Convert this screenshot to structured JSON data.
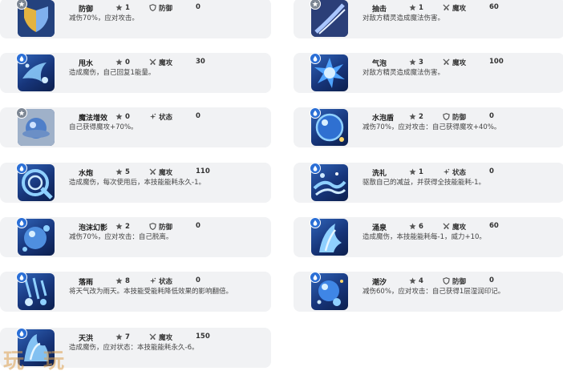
{
  "skills_left": [
    {
      "name": "防御",
      "cost": "1",
      "category": "防御",
      "power": "0",
      "desc": "减伤70%，应对攻击。",
      "badge": "normal",
      "art": "shield-art"
    },
    {
      "name": "甩水",
      "cost": "0",
      "category": "魔攻",
      "power": "30",
      "desc": "造成魔伤，自己回复1能量。",
      "badge": "water",
      "art": "water-splash-art"
    },
    {
      "name": "魔法增效",
      "cost": "0",
      "category": "状态",
      "power": "0",
      "desc": "自己获得魔攻+70%。",
      "badge": "normal",
      "art": "magic-orb-art"
    },
    {
      "name": "水炮",
      "cost": "5",
      "category": "魔攻",
      "power": "110",
      "desc": "造成魔伤，每次使用后，本技能能耗永久-1。",
      "badge": "water",
      "art": "water-cannon-art"
    },
    {
      "name": "泡沫幻影",
      "cost": "2",
      "category": "防御",
      "power": "0",
      "desc": "减伤70%，应对攻击：自己脱离。",
      "badge": "water",
      "art": "bubble-art"
    },
    {
      "name": "落雨",
      "cost": "8",
      "category": "状态",
      "power": "0",
      "desc": "将天气改为雨天。本技能受能耗降低效果的影响翻倍。",
      "badge": "water",
      "art": "rain-art"
    },
    {
      "name": "天洪",
      "cost": "7",
      "category": "魔攻",
      "power": "150",
      "desc": "造成魔伤，应对状态：本技能能耗永久-6。",
      "badge": "water",
      "art": "flood-art"
    }
  ],
  "skills_right": [
    {
      "name": "抽击",
      "cost": "1",
      "category": "魔攻",
      "power": "60",
      "desc": "对敌方精灵造成魔法伤害。",
      "badge": "normal",
      "art": "lash-art"
    },
    {
      "name": "气泡",
      "cost": "3",
      "category": "魔攻",
      "power": "100",
      "desc": "对敌方精灵造成魔法伤害。",
      "badge": "water",
      "art": "bubble-burst-art"
    },
    {
      "name": "水泡盾",
      "cost": "2",
      "category": "防御",
      "power": "0",
      "desc": "减伤70%，应对攻击：自己获得魔攻+40%。",
      "badge": "water",
      "art": "bubble-shield-art"
    },
    {
      "name": "洗礼",
      "cost": "1",
      "category": "状态",
      "power": "0",
      "desc": "驱散自己的减益，并获得全技能能耗-1。",
      "badge": "water",
      "art": "baptism-art"
    },
    {
      "name": "涌泉",
      "cost": "6",
      "category": "魔攻",
      "power": "60",
      "desc": "造成魔伤，本技能能耗每-1，威力+10。",
      "badge": "water",
      "art": "spring-art"
    },
    {
      "name": "潮汐",
      "cost": "4",
      "category": "防御",
      "power": "0",
      "desc": "减伤60%，应对攻击：自己获得1层湿润印记。",
      "badge": "water",
      "art": "tide-art"
    }
  ],
  "watermark": {
    "left": "玩",
    "right": "玩"
  },
  "colors": {
    "card_bg": "#f1f2f4",
    "water_badge": "#2b6fd6",
    "normal_badge": "#7d8794",
    "art_dark": "#17357a"
  }
}
